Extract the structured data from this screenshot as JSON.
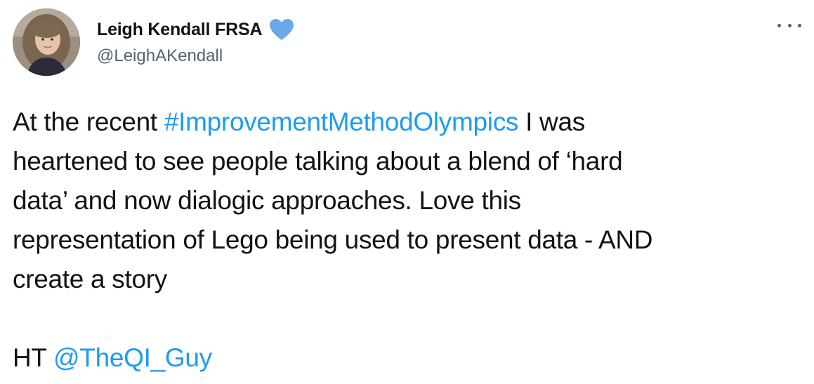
{
  "author": {
    "name": "Leigh Kendall FRSA",
    "handle": "@LeighAKendall",
    "badge_icon": "blue-heart-icon",
    "badge_color": "#6aa9e9"
  },
  "menu": {
    "icon": "more-options-icon"
  },
  "tweet": {
    "line1_prefix": "At the recent ",
    "hashtag": "#ImprovementMethodOlympics",
    "line1_suffix": " I was",
    "line2": "heartened to see people talking about a blend of ‘hard",
    "line3": "data’ and now dialogic approaches. Love this",
    "line4": "representation of Lego being used to present data - AND",
    "line5": "create a story",
    "ht_prefix": "HT ",
    "mention": "@TheQI_Guy"
  },
  "colors": {
    "link": "#1d9bf0",
    "text": "#0f1419",
    "secondary": "#536471"
  }
}
